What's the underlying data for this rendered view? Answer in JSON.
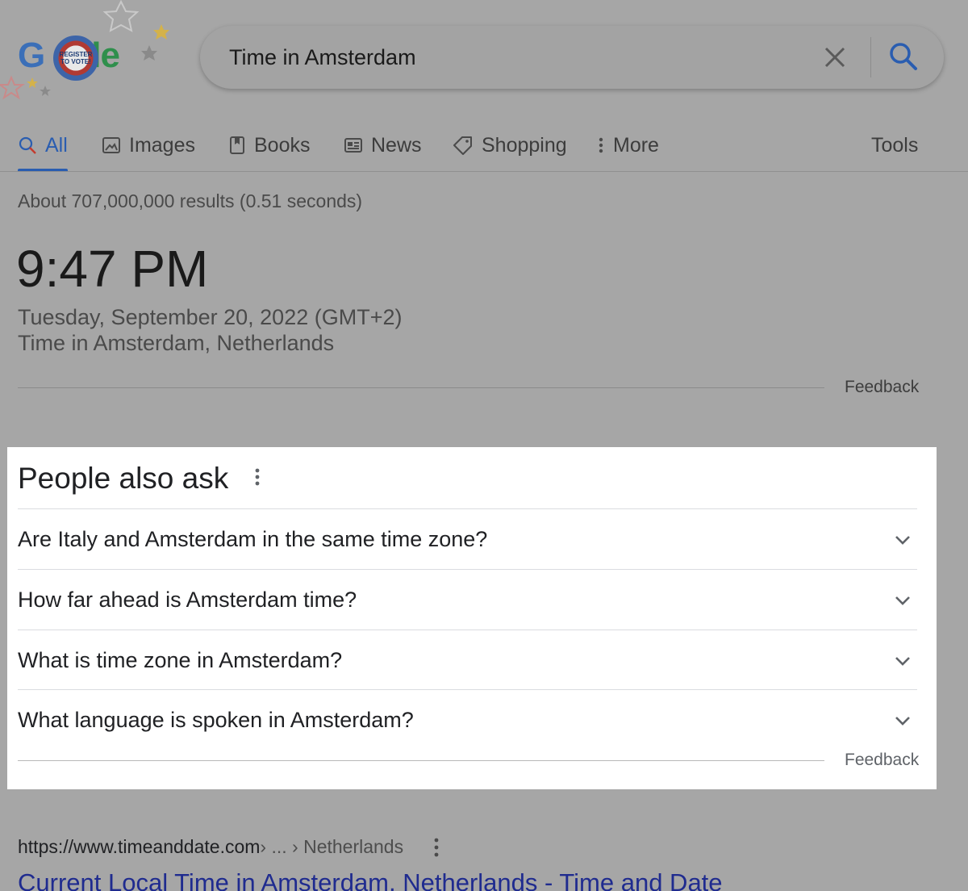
{
  "logo": {
    "letters": [
      "G",
      "le"
    ],
    "badge_line1": "REGISTER",
    "badge_line2": "TO VOTE!"
  },
  "search": {
    "query": "Time in Amsterdam"
  },
  "tabs": [
    {
      "label": "All",
      "icon": "search-icon",
      "active": true
    },
    {
      "label": "Images",
      "icon": "image-icon"
    },
    {
      "label": "Books",
      "icon": "book-icon"
    },
    {
      "label": "News",
      "icon": "news-icon"
    },
    {
      "label": "Shopping",
      "icon": "tag-icon"
    },
    {
      "label": "More",
      "icon": "more-vertical-icon"
    }
  ],
  "tools_label": "Tools",
  "stats": "About 707,000,000 results (0.51 seconds)",
  "clock": {
    "time": "9:47 PM",
    "date": "Tuesday, September 20, 2022 (GMT+2)",
    "location": "Time in Amsterdam, Netherlands",
    "feedback": "Feedback"
  },
  "people_also_ask": {
    "title": "People also ask",
    "questions": [
      "Are Italy and Amsterdam in the same time zone?",
      "How far ahead is Amsterdam time?",
      "What is time zone in Amsterdam?",
      "What language is spoken in Amsterdam?"
    ],
    "feedback": "Feedback"
  },
  "result": {
    "url": "https://www.timeanddate.com",
    "breadcrumb": " › ... › Netherlands",
    "title": "Current Local Time in Amsterdam, Netherlands - Time and Date"
  },
  "colors": {
    "accent": "#2a5db0",
    "link": "#1f2b8f",
    "overlay": "#a6a6a6"
  }
}
